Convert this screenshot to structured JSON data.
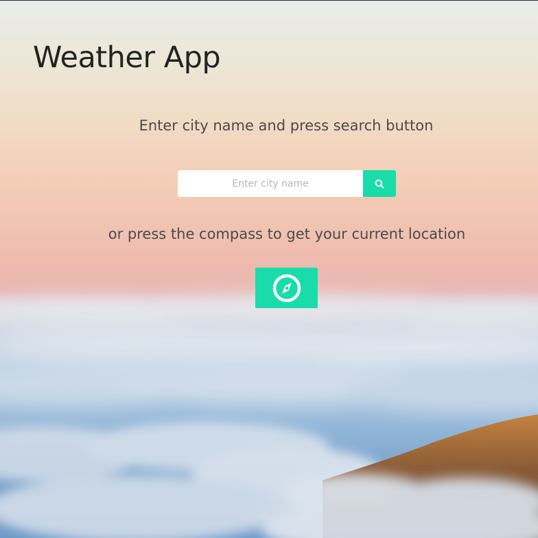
{
  "app": {
    "title": "Weather App"
  },
  "search": {
    "instruction": "Enter city name and press search button",
    "placeholder": "Enter city name",
    "value": "",
    "button_icon": "search-icon"
  },
  "location": {
    "instruction": "or press the compass to get your current location",
    "button_icon": "compass-icon"
  },
  "colors": {
    "accent": "#19dcaa",
    "title_text": "#232323",
    "body_text": "#4a4a4a",
    "input_background": "#ffffff"
  }
}
